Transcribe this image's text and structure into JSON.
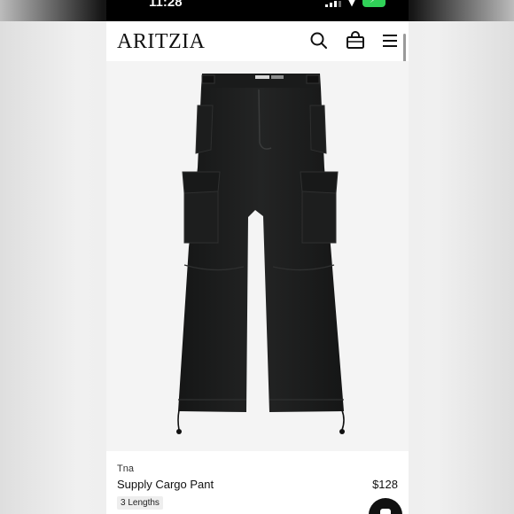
{
  "status_bar": {
    "time": "11:28"
  },
  "header": {
    "logo": "ARITZIA",
    "icons": [
      "search-icon",
      "shopping-bag-icon",
      "hamburger-menu-icon"
    ]
  },
  "product": {
    "brand": "Tna",
    "name": "Supply Cargo Pant",
    "price": "$128",
    "lengths_badge": "3 Lengths"
  },
  "colors": {
    "background": "#ffffff",
    "text": "#111111",
    "garment": "#1b1c1c",
    "badge_bg": "#eeeeee"
  }
}
